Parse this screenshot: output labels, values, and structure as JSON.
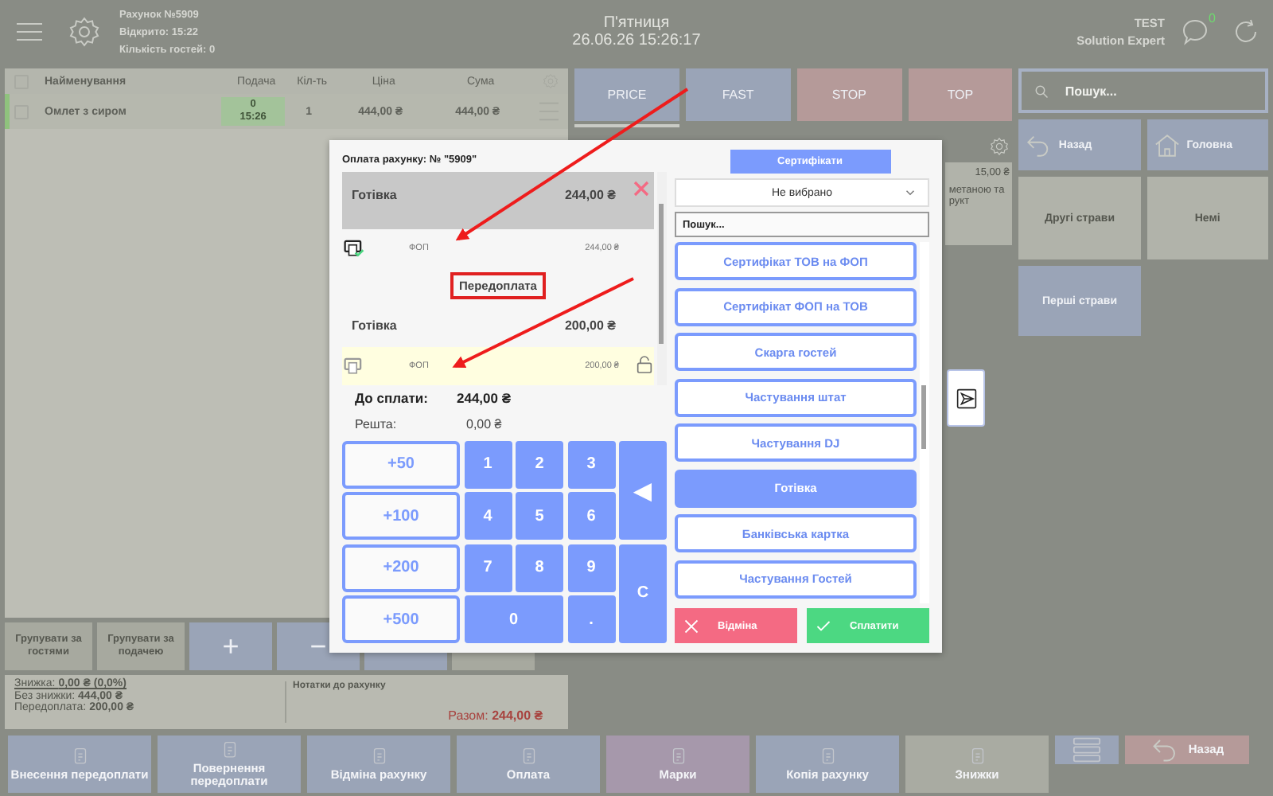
{
  "header": {
    "bill": "Рахунок №5909",
    "opened": "Відкрито: 15:22",
    "guests": "Кількість гостей: 0",
    "day": "П'ятниця",
    "datetime": "26.06.26 15:26:17",
    "user": "TEST",
    "company": "Solution Expert",
    "messages": "0"
  },
  "order_table": {
    "all_checked": false,
    "columns": [
      "Найменування",
      "Подача",
      "Кіл-ть",
      "Ціна",
      "Сума"
    ],
    "rows": [
      {
        "name": "Омлет з сиром",
        "course": "0",
        "time": "15:26",
        "qty": "1",
        "price": "444,00 ₴",
        "sum": "444,00 ₴",
        "checked": false
      }
    ]
  },
  "group_buttons": [
    "Групувати за гостями",
    "Групувати за подачею"
  ],
  "action_buttons": [
    "+",
    "−"
  ],
  "summary": {
    "discount_label": "Знижка:",
    "discount": "0,00 ₴ (0,0%)",
    "without_label": "Без знижки:",
    "without": "444,00 ₴",
    "prepaid_label": "Передоплата:",
    "prepaid": "200,00 ₴",
    "notes": "Нотатки до рахунку",
    "total_label": "Разом:",
    "total": "244,00 ₴"
  },
  "bottom_bar": [
    {
      "kind": "button",
      "label": "Внесення передоплати",
      "color": "#9aa4b7"
    },
    {
      "kind": "button",
      "label": "Повернення передоплати",
      "color": "#9aa4b7"
    },
    {
      "kind": "button",
      "label": "Відміна рахунку",
      "color": "#9aa4b7"
    },
    {
      "kind": "button",
      "label": "Оплата",
      "color": "#9aa4b7"
    },
    {
      "kind": "button",
      "label": "Марки",
      "color": "#a698ab"
    },
    {
      "kind": "button",
      "label": "Копія рахунку",
      "color": "#9aa4b7"
    },
    {
      "kind": "button",
      "label": "Знижки",
      "color": "#a9aba2"
    },
    {
      "kind": "menu",
      "color": "#9aa4b7"
    },
    {
      "kind": "back",
      "label": "Назад",
      "color": "#b59a99"
    }
  ],
  "categories": [
    {
      "label": "PRICE",
      "color": "#9aa4b7",
      "selected": true
    },
    {
      "label": "FAST",
      "color": "#9aa4b7",
      "selected": false
    },
    {
      "label": "STOP",
      "color": "#b59a99",
      "selected": false
    },
    {
      "label": "TOP",
      "color": "#b59a99",
      "selected": false
    }
  ],
  "product_tile": {
    "price": "15,00 ₴",
    "name_lines": [
      "метаною та",
      "рукт"
    ]
  },
  "menu_search": {
    "placeholder": "Пошук..."
  },
  "menu_tiles": [
    {
      "kind": "back",
      "label": "Назад"
    },
    {
      "kind": "home",
      "label": "Головна"
    },
    {
      "kind": "group",
      "label": "Другі страви"
    },
    {
      "kind": "group",
      "label": "Немі"
    },
    {
      "kind": "folder",
      "label": "Перші страви"
    }
  ],
  "payment_dialog": {
    "title": "Оплата рахунку: № \"5909\"",
    "payments": [
      {
        "kind": "payment",
        "method": "Готівка",
        "amount": "244,00 ₴",
        "active": true
      },
      {
        "kind": "fiscal",
        "name": "ФОП",
        "amount": "244,00 ₴",
        "printed": true
      },
      {
        "kind": "section",
        "label": "Передоплата",
        "highlighted": true
      },
      {
        "kind": "payment",
        "method": "Готівка",
        "amount": "200,00 ₴",
        "active": false
      },
      {
        "kind": "fiscal",
        "name": "ФОП",
        "amount": "200,00 ₴",
        "printed": false
      }
    ],
    "due_label": "До сплати:",
    "due": "244,00 ₴",
    "change_label": "Решта:",
    "change": "0,00 ₴",
    "quick_amounts": [
      "+50",
      "+100",
      "+200",
      "+500"
    ],
    "keys": [
      "1",
      "2",
      "3",
      "4",
      "5",
      "6",
      "7",
      "8",
      "9",
      "0",
      "."
    ],
    "backspace": "◀",
    "clear": "C",
    "certificates": "Сертифікати",
    "select": "Не вибрано",
    "search": {
      "placeholder": "Пошук..."
    },
    "methods": [
      {
        "label": "Сертифікат ТОВ на ФОП",
        "selected": false
      },
      {
        "label": "Сертифікат ФОП на ТОВ",
        "selected": false
      },
      {
        "label": "Скарга гостей",
        "selected": false
      },
      {
        "label": "Частування штат",
        "selected": false
      },
      {
        "label": "Частування DJ",
        "selected": false
      },
      {
        "label": "Готівка",
        "selected": true
      },
      {
        "label": "Банківська картка",
        "selected": false
      },
      {
        "label": "Частування Гостей",
        "selected": false
      }
    ],
    "cancel": "Відміна",
    "pay": "Сплатити"
  }
}
